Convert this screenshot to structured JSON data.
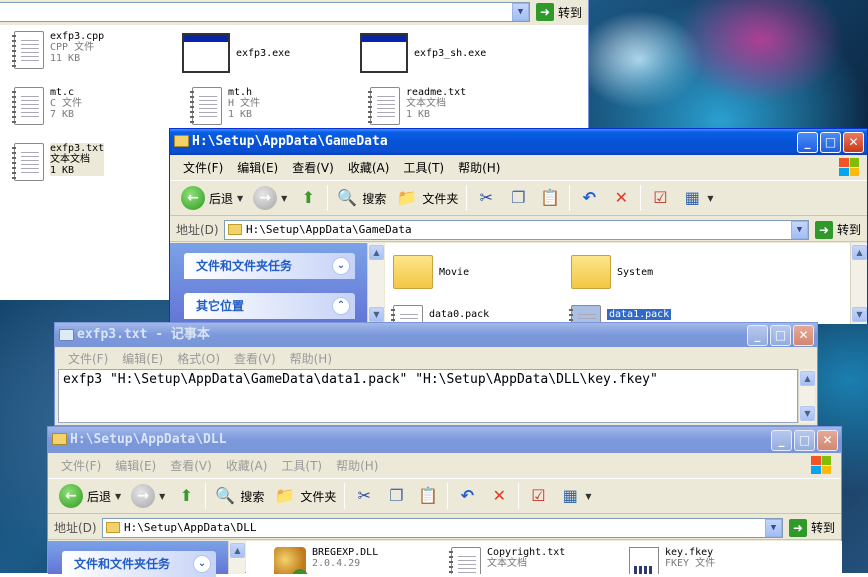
{
  "bg_window": {
    "goto_label": "转到",
    "files": [
      {
        "name": "exfp3.cpp",
        "type": "CPP 文件",
        "size": "11 KB"
      },
      {
        "name": "exfp3.exe",
        "type": "",
        "size": ""
      },
      {
        "name": "exfp3_sh.exe",
        "type": "",
        "size": ""
      },
      {
        "name": "mt.c",
        "type": "C 文件",
        "size": "7 KB"
      },
      {
        "name": "mt.h",
        "type": "H 文件",
        "size": "1 KB"
      },
      {
        "name": "readme.txt",
        "type": "文本文档",
        "size": "1 KB"
      },
      {
        "name": "exfp3.txt",
        "type": "文本文档",
        "size": "1 KB"
      }
    ]
  },
  "gamedata_window": {
    "title": "H:\\Setup\\AppData\\GameData",
    "menu": [
      "文件(F)",
      "编辑(E)",
      "查看(V)",
      "收藏(A)",
      "工具(T)",
      "帮助(H)"
    ],
    "toolbar": {
      "back": "后退",
      "search": "搜索",
      "folders": "文件夹"
    },
    "address_label": "地址(D)",
    "address": "H:\\Setup\\AppData\\GameData",
    "goto_label": "转到",
    "tasks": [
      "文件和文件夹任务",
      "其它位置"
    ],
    "files": [
      {
        "name": "Movie"
      },
      {
        "name": "System"
      },
      {
        "name": "data0.pack"
      },
      {
        "name": "data1.pack"
      }
    ]
  },
  "notepad_window": {
    "title": "exfp3.txt - 记事本",
    "menu": [
      "文件(F)",
      "编辑(E)",
      "格式(O)",
      "查看(V)",
      "帮助(H)"
    ],
    "content": "exfp3 \"H:\\Setup\\AppData\\GameData\\data1.pack\" \"H:\\Setup\\AppData\\DLL\\key.fkey\""
  },
  "dll_window": {
    "title": "H:\\Setup\\AppData\\DLL",
    "menu": [
      "文件(F)",
      "编辑(E)",
      "查看(V)",
      "收藏(A)",
      "工具(T)",
      "帮助(H)"
    ],
    "toolbar": {
      "back": "后退",
      "search": "搜索",
      "folders": "文件夹"
    },
    "address_label": "地址(D)",
    "address": "H:\\Setup\\AppData\\DLL",
    "goto_label": "转到",
    "tasks": [
      "文件和文件夹任务"
    ],
    "files": [
      {
        "name": "BREGEXP.DLL",
        "meta": "2.0.4.29"
      },
      {
        "name": "Copyright.txt",
        "meta": "文本文档"
      },
      {
        "name": "key.fkey",
        "meta": "FKEY 文件"
      }
    ]
  },
  "colors": {
    "title_active": "#0553d7",
    "title_inactive": "#7b98dc",
    "selection": "#316ac5"
  }
}
